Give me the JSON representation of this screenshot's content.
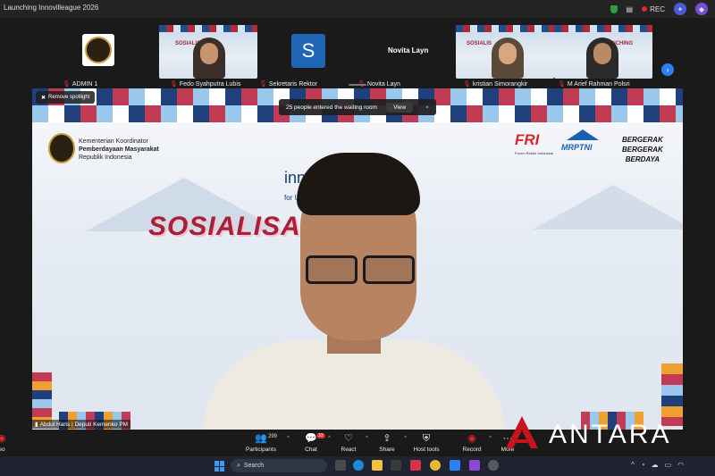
{
  "window": {
    "title": "Launching Innovilleague 2026",
    "rec_label": "REC"
  },
  "participants_strip": [
    {
      "name": "ADMIN 1",
      "kind": "logo"
    },
    {
      "name": "Fedo Syahputra Lubis",
      "kind": "video"
    },
    {
      "name": "Sekretaris Rektor",
      "kind": "avatar",
      "initial": "S"
    },
    {
      "name": "Novita Layn",
      "kind": "name-only",
      "display": "Novita Layn"
    },
    {
      "name": "kristian Simorangkir",
      "kind": "video"
    },
    {
      "name": "M Arief Rahman Polsri",
      "kind": "video"
    }
  ],
  "thumb_text": {
    "sosialisasi": "SOSIALIS",
    "launching": "UNCHING"
  },
  "main_share": {
    "ministry_line1": "Kementerian Koordinator",
    "ministry_line2": "Pemberdayaan Masyarakat",
    "ministry_line3": "Republik Indonesia",
    "fri": "FRI",
    "fri_sub": "Forum Rektor Indonesia",
    "mrptni": "MRPTNI",
    "slogan1": "BERGERAK",
    "slogan2": "BERGERAK",
    "slogan3": "BERDAYA",
    "inno": "inno",
    "for_u": "for Ur",
    "headline": "SOSIALISA          CHING"
  },
  "overlays": {
    "remove_spotlight": "Remove spotlight",
    "waiting_room": "25 people entered the waiting room",
    "view": "View",
    "close": "×",
    "speaker_name": "Abdul Haris | Deputi Kemenko PM"
  },
  "toolbar": {
    "video_label": "eo",
    "participants_label": "Participants",
    "participants_count": "299",
    "chat_label": "Chat",
    "chat_badge": "33",
    "react_label": "React",
    "share_label": "Share",
    "host_tools_label": "Host tools",
    "record_label": "Record",
    "more_label": "More"
  },
  "watermark": "ANTARA",
  "taskbar": {
    "search_placeholder": "Search"
  },
  "colors": {
    "accent_blue": "#2d7ff9",
    "rec_red": "#e02828",
    "brand_red": "#a8203a"
  }
}
